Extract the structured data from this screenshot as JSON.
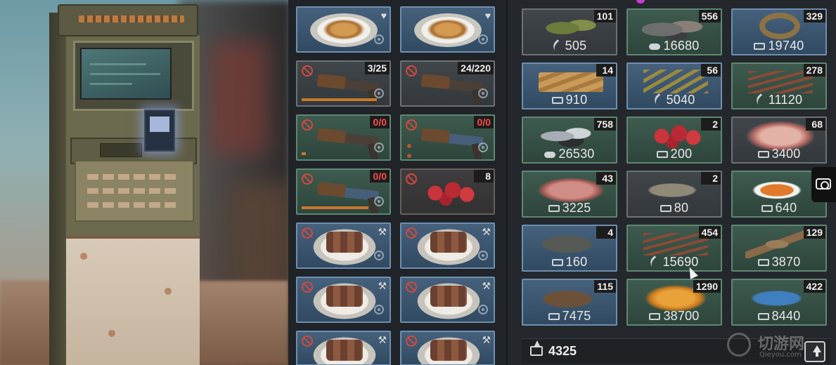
{
  "inventory": [
    {
      "slot": "blue",
      "art": "bread",
      "icon": "heart-food-icon",
      "locked": true
    },
    {
      "slot": "blue",
      "art": "bread",
      "icon": "heart-food-icon",
      "locked": true
    },
    {
      "slot": "grey",
      "art": "gun",
      "count": "3/25",
      "ban": true,
      "bar": 0.9,
      "locked": true
    },
    {
      "slot": "grey",
      "art": "gun",
      "count": "24/220",
      "ban": true,
      "locked": true
    },
    {
      "slot": "green",
      "art": "gun",
      "count": "0/0",
      "countColor": "red",
      "ban": true,
      "bar": 0.05,
      "locked": true
    },
    {
      "slot": "green",
      "art": "gun-blue",
      "count": "0/0",
      "countColor": "red",
      "ban": true,
      "dots": true,
      "locked": true
    },
    {
      "slot": "green",
      "art": "gun-blue",
      "count": "0/0",
      "countColor": "red",
      "ban": true,
      "bar": 0.8,
      "locked": true
    },
    {
      "slot": "red",
      "art": "berries",
      "count": "8",
      "ban": true
    },
    {
      "slot": "blue",
      "art": "cake",
      "icon": "axe-icon",
      "ban": true,
      "locked": true
    },
    {
      "slot": "blue",
      "art": "cake",
      "icon": "axe-icon",
      "ban": true,
      "locked": true
    },
    {
      "slot": "blue",
      "art": "cake",
      "icon": "axe-icon",
      "ban": true,
      "locked": true
    },
    {
      "slot": "blue",
      "art": "cake",
      "icon": "axe-icon",
      "ban": true,
      "locked": true
    },
    {
      "slot": "blue",
      "art": "cake",
      "icon": "axe-icon",
      "ban": true
    },
    {
      "slot": "blue",
      "art": "cake",
      "icon": "axe-icon",
      "ban": true
    }
  ],
  "shop": [
    {
      "count": "101",
      "price": "505",
      "currency": "leaf",
      "art": "herb",
      "slot": "grey"
    },
    {
      "count": "556",
      "price": "16680",
      "currency": "cloud",
      "art": "rocks",
      "slot": "green"
    },
    {
      "count": "329",
      "price": "19740",
      "currency": "ticket",
      "art": "wreath",
      "slot": "blue"
    },
    {
      "count": "14",
      "price": "910",
      "currency": "ticket",
      "art": "planks",
      "slot": "blue"
    },
    {
      "count": "56",
      "price": "5040",
      "currency": "leaf",
      "art": "sticks",
      "slot": "blue"
    },
    {
      "count": "278",
      "price": "11120",
      "currency": "leaf",
      "art": "twigs",
      "slot": "green"
    },
    {
      "count": "758",
      "price": "26530",
      "currency": "cloud",
      "art": "ore",
      "slot": "green"
    },
    {
      "count": "2",
      "price": "200",
      "currency": "ticket",
      "art": "berries",
      "slot": "green"
    },
    {
      "count": "68",
      "price": "3400",
      "currency": "ticket",
      "art": "steak",
      "slot": "grey"
    },
    {
      "count": "43",
      "price": "3225",
      "currency": "ticket",
      "art": "meat",
      "slot": "green"
    },
    {
      "count": "2",
      "price": "80",
      "currency": "ticket",
      "art": "fish",
      "slot": "grey"
    },
    {
      "count": "",
      "price": "640",
      "currency": "ticket",
      "art": "fish koi",
      "slot": "green"
    },
    {
      "count": "4",
      "price": "160",
      "currency": "ticket",
      "art": "fish dark",
      "slot": "blue"
    },
    {
      "count": "454",
      "price": "15690",
      "currency": "leaf",
      "art": "twigs",
      "slot": "green"
    },
    {
      "count": "129",
      "price": "3870",
      "currency": "ticket",
      "art": "bone",
      "slot": "green"
    },
    {
      "count": "115",
      "price": "7475",
      "currency": "ticket",
      "art": "trout",
      "slot": "blue"
    },
    {
      "count": "1290",
      "price": "38700",
      "currency": "ticket",
      "art": "amber",
      "slot": "green"
    },
    {
      "count": "422",
      "price": "8440",
      "currency": "ticket",
      "art": "fish blue",
      "slot": "green"
    }
  ],
  "bottom_bar": {
    "currency_icon": "ticket-icon",
    "value": "4325"
  },
  "watermark": {
    "title": "切游网",
    "subtitle": "Qieyou.com"
  },
  "colors": {
    "accent": "#c43bd1",
    "slot_blue": "#6e8fb0",
    "slot_green": "#5f8773",
    "count_red": "#ff4b4b"
  }
}
